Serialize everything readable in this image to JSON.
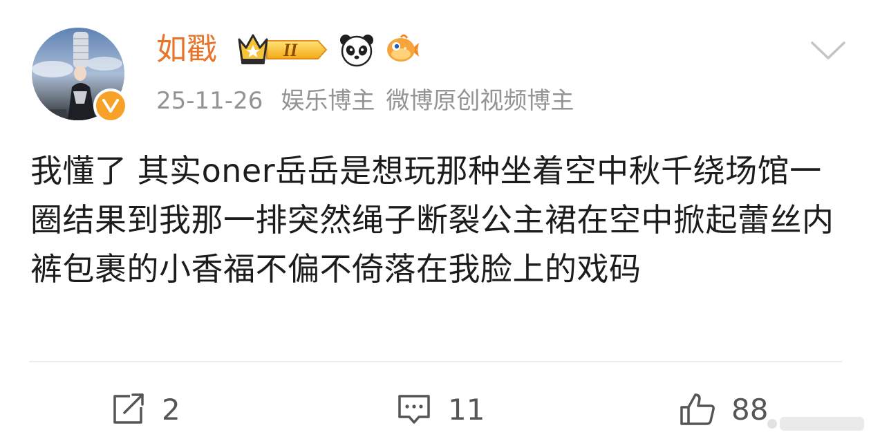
{
  "user": {
    "name": "如戳",
    "level_badge": "II",
    "verified": true
  },
  "meta": {
    "date": "25-11-26",
    "tags": [
      "娱乐博主",
      "微博原创视频博主"
    ]
  },
  "post": {
    "text": "我懂了 其实oner岳岳是想玩那种坐着空中秋千绕场馆一圈结果到我那一排突然绳子断裂公主裙在空中掀起蕾丝内裤包裹的小香福不偏不倚落在我脸上的戏码"
  },
  "actions": {
    "repost_count": "2",
    "comment_count": "11",
    "like_count": "88"
  },
  "icons": {
    "verified": "verified-v-icon",
    "crown": "crown-badge-icon",
    "panda": "panda-icon",
    "fish": "fish-icon",
    "more": "chevron-down-icon",
    "repost": "repost-icon",
    "comment": "comment-icon",
    "like": "thumbs-up-icon"
  },
  "colors": {
    "username": "#e8742a",
    "meta": "#939393",
    "verified_badge": "#f7a128",
    "text": "#1c1c1c",
    "action": "#555555"
  }
}
